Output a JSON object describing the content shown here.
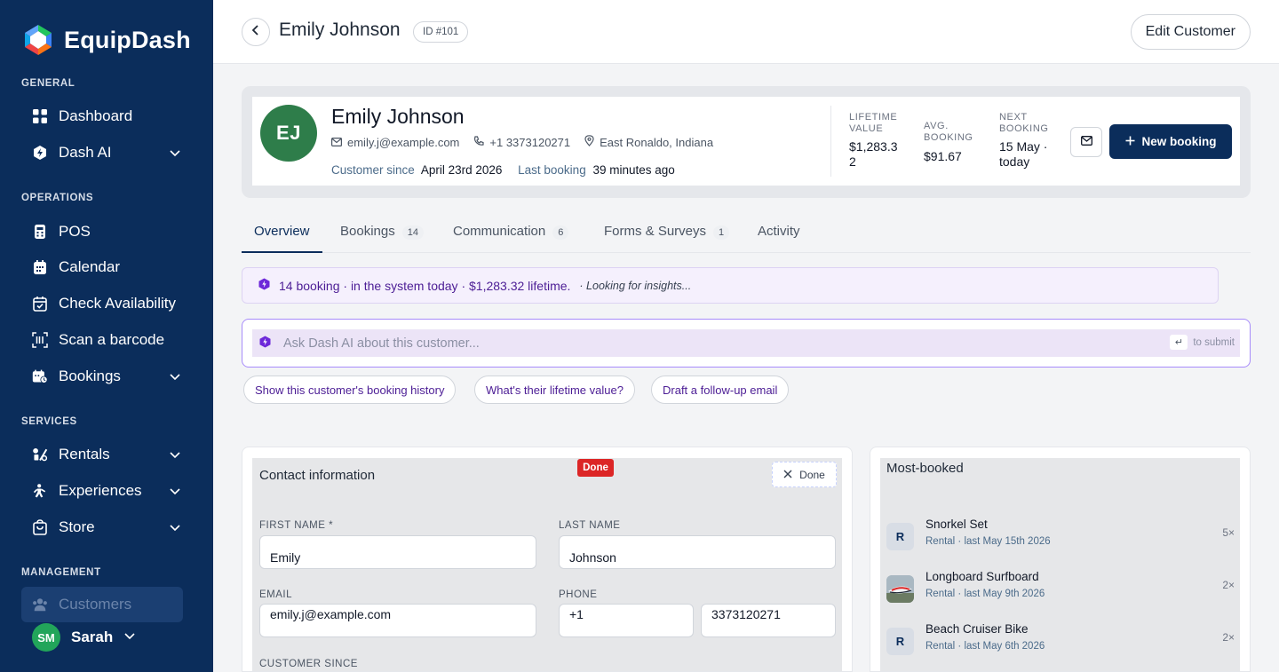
{
  "brand": {
    "name": "EquipDash"
  },
  "sidebar": {
    "sections": {
      "general": "GENERAL",
      "operations": "OPERATIONS",
      "services": "SERVICES",
      "management": "MANAGEMENT"
    },
    "items": [
      {
        "label": "Dashboard",
        "icon": "grid-icon"
      },
      {
        "label": "Dash AI",
        "icon": "dash-ai-icon"
      },
      {
        "label": "POS",
        "icon": "pos-terminal-icon"
      },
      {
        "label": "Calendar",
        "icon": "calendar-icon"
      },
      {
        "label": "Check Availability",
        "icon": "calendar-check-icon"
      },
      {
        "label": "Scan a barcode",
        "icon": "barcode-scan-icon"
      },
      {
        "label": "Bookings",
        "icon": "bookings-icon"
      },
      {
        "label": "Rentals",
        "icon": "rentals-icon"
      },
      {
        "label": "Experiences",
        "icon": "experiences-icon"
      },
      {
        "label": "Store",
        "icon": "store-icon"
      },
      {
        "label": "Customers",
        "icon": "customers-icon"
      }
    ],
    "user": {
      "initials": "SM",
      "name": "Sarah",
      "avatar_color": "#22a55a"
    }
  },
  "header": {
    "title": "Emily Johnson",
    "id_badge": "ID #101",
    "edit_button": "Edit Customer"
  },
  "profile": {
    "initials": "EJ",
    "name": "Emily Johnson",
    "email": "emily.j@example.com",
    "phone": "+1 3373120271",
    "location": "East Ronaldo, Indiana",
    "since_label": "Customer since",
    "since_value": "April 23rd 2026",
    "last_label": "Last booking",
    "last_value": "39 minutes ago",
    "stats": {
      "lifetime_label_1": "LIFETIME",
      "lifetime_label_2": "VALUE",
      "lifetime_value_1": "$1,283.3",
      "lifetime_value_2": "2",
      "avg_label_1": "AVG.",
      "avg_label_2": "BOOKING",
      "avg_value": "$91.67",
      "next_label_1": "NEXT",
      "next_label_2": "BOOKING",
      "next_value_1": "15 May ·",
      "next_value_2": "today"
    },
    "new_booking": "New booking"
  },
  "tabs": [
    {
      "label": "Overview",
      "count": ""
    },
    {
      "label": "Bookings",
      "count": "14"
    },
    {
      "label": "Communication",
      "count": "6"
    },
    {
      "label": "Forms & Surveys",
      "count": "1"
    },
    {
      "label": "Activity",
      "count": ""
    }
  ],
  "insight": {
    "text": "14 booking · in the system today · $1,283.32 lifetime.",
    "status": "· Looking for insights..."
  },
  "ask": {
    "placeholder": "Ask Dash AI about this customer...",
    "key": "↵",
    "hint": "to submit"
  },
  "suggestions": [
    "Show this customer's booking history",
    "What's their lifetime value?",
    "Draft a follow-up email"
  ],
  "contact": {
    "title": "Contact information",
    "badge": "Done",
    "done_button": "Done",
    "first_name_label": "FIRST NAME *",
    "first_name": "Emily",
    "last_name_label": "LAST NAME",
    "last_name": "Johnson",
    "email_label": "EMAIL",
    "email": "emily.j@example.com",
    "phone_label": "PHONE",
    "phone_code": "+1",
    "phone_number": "3373120271",
    "since_label": "CUSTOMER SINCE"
  },
  "most_booked": {
    "title": "Most-booked",
    "items": [
      {
        "thumb": "R",
        "name": "Snorkel Set",
        "sub": "Rental · last May 15th 2026",
        "count": "5×"
      },
      {
        "thumb": "",
        "name": "Longboard Surfboard",
        "sub": "Rental · last May 9th 2026",
        "count": "2×"
      },
      {
        "thumb": "R",
        "name": "Beach Cruiser Bike",
        "sub": "Rental · last May 6th 2026",
        "count": "2×"
      }
    ]
  },
  "colors": {
    "sidebar": "#0b2d5b",
    "primary": "#0b2d5b",
    "ai_purple": "#4c1d95",
    "avatar_green": "#2e7d4a",
    "danger": "#dc2626"
  }
}
